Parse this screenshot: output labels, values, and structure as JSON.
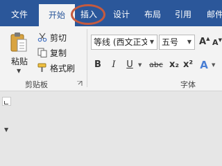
{
  "tabs": [
    {
      "label": "文件"
    },
    {
      "label": "开始"
    },
    {
      "label": "插入"
    },
    {
      "label": "设计"
    },
    {
      "label": "布局"
    },
    {
      "label": "引用"
    },
    {
      "label": "邮件"
    }
  ],
  "active_tab": "开始",
  "highlighted_tab": "插入",
  "clipboard": {
    "paste_label": "粘贴",
    "cut_label": "剪切",
    "copy_label": "复制",
    "format_painter_label": "格式刷",
    "group_label": "剪贴板"
  },
  "font": {
    "font_name_value": "等线 (西文正文",
    "font_size_value": "五号",
    "bold_label": "B",
    "italic_label": "I",
    "underline_label": "U",
    "strikethrough_label": "abc",
    "subscript_label": "x₂",
    "superscript_label": "x²",
    "grow_label": "A",
    "shrink_label": "A",
    "text_effects_label": "A",
    "group_label": "字体"
  },
  "colors": {
    "tabbar": "#2b579a",
    "ribbon": "#f3f3f3",
    "highlight_circle": "#c55a3f"
  }
}
